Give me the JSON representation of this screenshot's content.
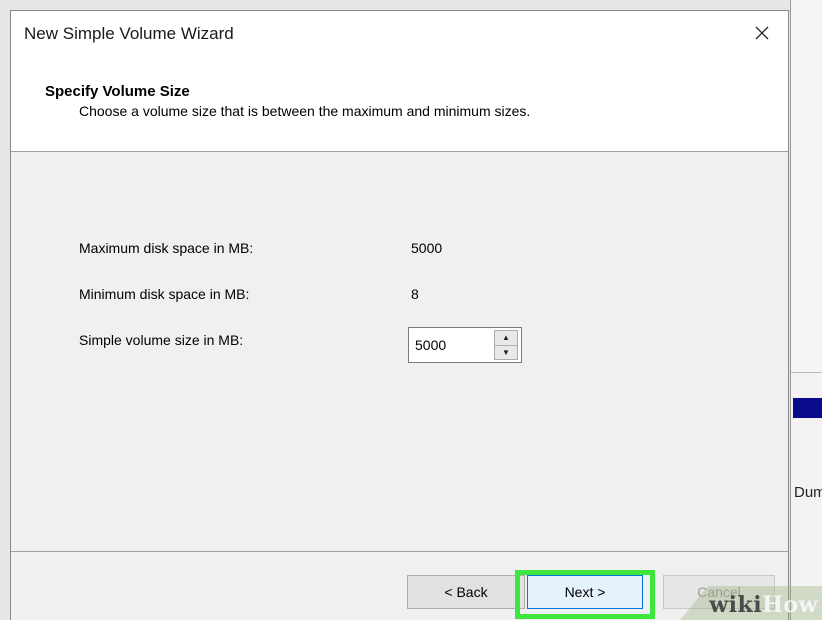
{
  "background_window": {
    "visible_text": "Dum"
  },
  "dialog": {
    "title": "New Simple Volume Wizard",
    "close_symbol": "×"
  },
  "header": {
    "title": "Specify Volume Size",
    "subtitle": "Choose a volume size that is between the maximum and minimum sizes."
  },
  "fields": [
    {
      "label": "Maximum disk space in MB:",
      "value": "5000"
    },
    {
      "label": "Minimum disk space in MB:",
      "value": "8"
    },
    {
      "label": "Simple volume size in MB:",
      "value": "5000"
    }
  ],
  "spinner": {
    "up_symbol": "▲",
    "down_symbol": "▼"
  },
  "buttons": {
    "back": "< Back",
    "next": "Next >",
    "cancel": "Cancel"
  },
  "watermark": {
    "part1": "wiki",
    "part2": "How"
  },
  "colors": {
    "highlight": "#3ee63e",
    "accent_blue": "#0078d7"
  },
  "icons": {
    "close": "close-icon",
    "spin_up": "arrow-up-icon",
    "spin_down": "arrow-down-icon"
  }
}
